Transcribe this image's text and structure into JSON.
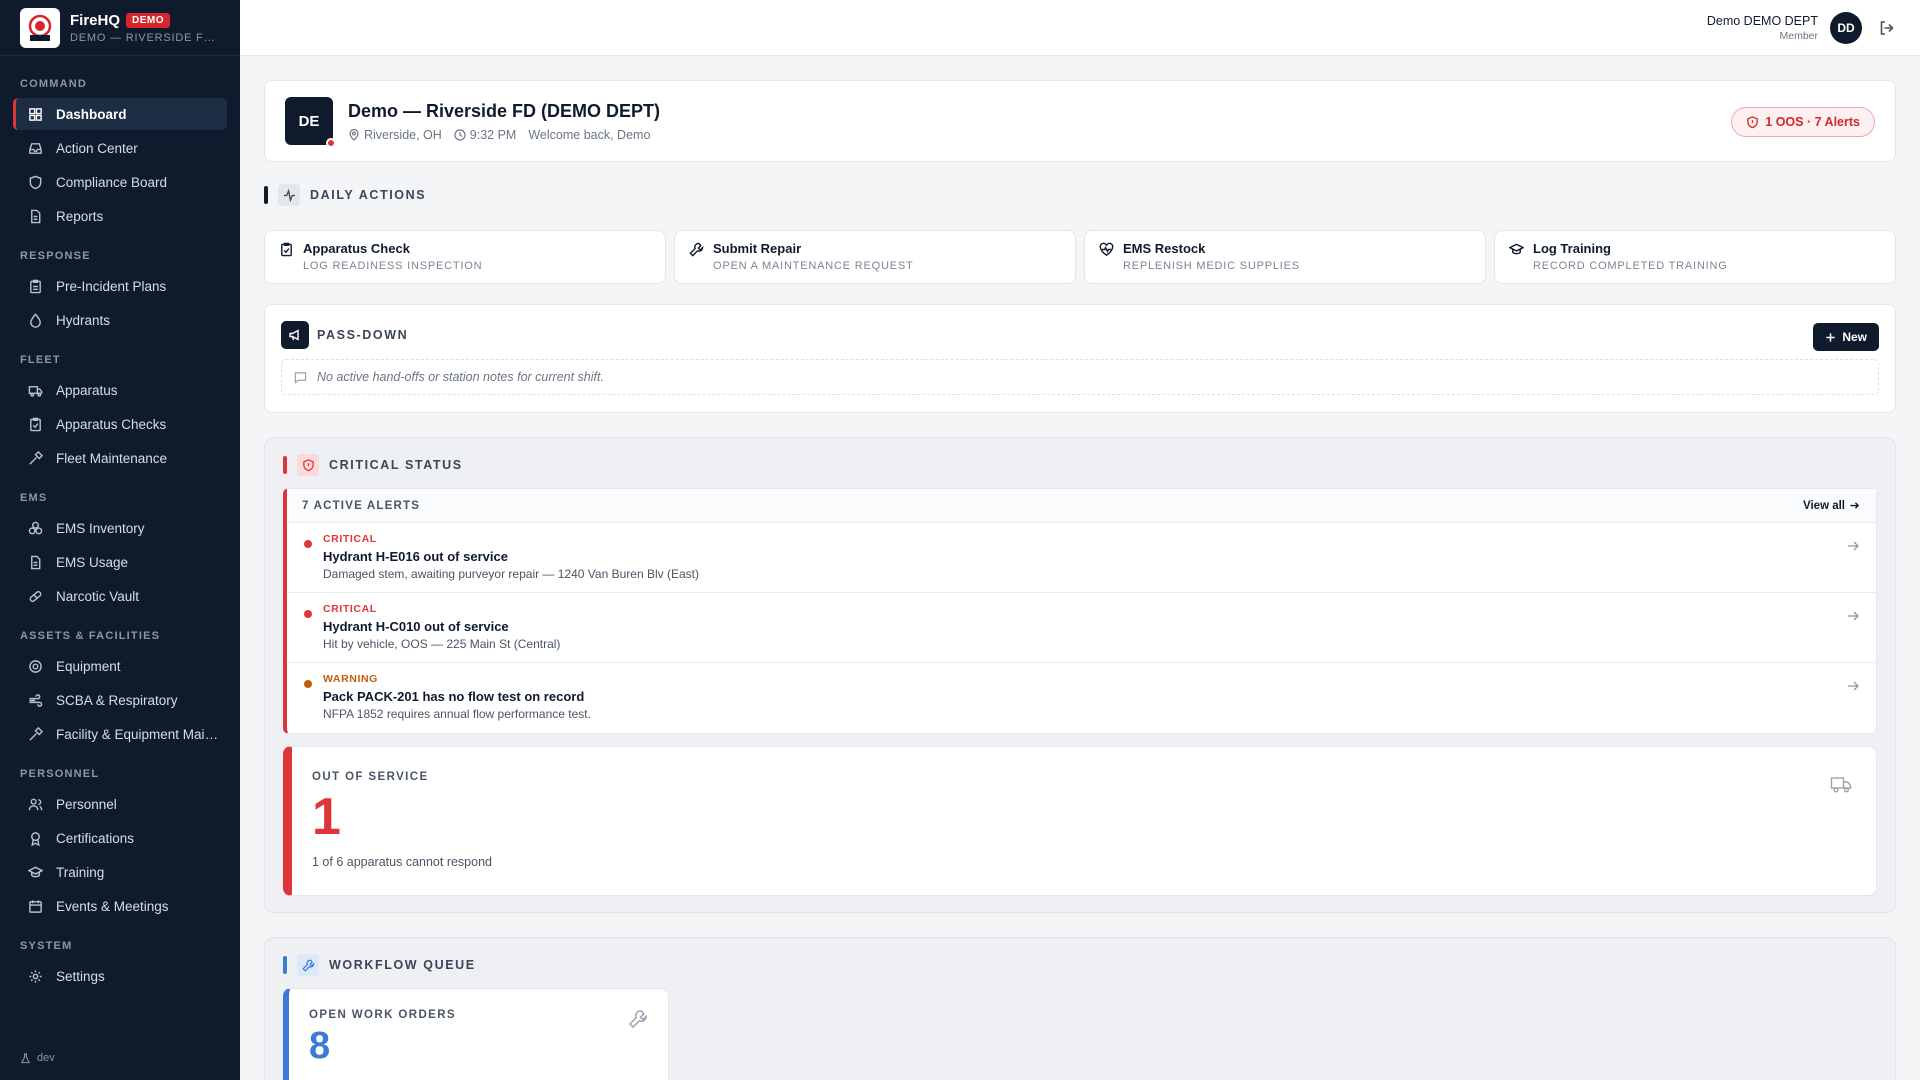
{
  "brand": {
    "name": "FireHQ",
    "badge": "DEMO",
    "subtitle": "DEMO — RIVERSIDE FD (DEMO DEPT)"
  },
  "sidebar": {
    "sections": [
      {
        "title": "COMMAND",
        "items": [
          {
            "label": "Dashboard",
            "icon": "grid-icon",
            "active": true
          },
          {
            "label": "Action Center",
            "icon": "inbox-icon"
          },
          {
            "label": "Compliance Board",
            "icon": "shield-icon"
          },
          {
            "label": "Reports",
            "icon": "document-icon"
          }
        ]
      },
      {
        "title": "RESPONSE",
        "items": [
          {
            "label": "Pre-Incident Plans",
            "icon": "clipboard-icon"
          },
          {
            "label": "Hydrants",
            "icon": "droplet-icon"
          }
        ]
      },
      {
        "title": "FLEET",
        "items": [
          {
            "label": "Apparatus",
            "icon": "truck-icon"
          },
          {
            "label": "Apparatus Checks",
            "icon": "clipboard-check-icon"
          },
          {
            "label": "Fleet Maintenance",
            "icon": "hammer-icon"
          }
        ]
      },
      {
        "title": "EMS",
        "items": [
          {
            "label": "EMS Inventory",
            "icon": "cubes-icon"
          },
          {
            "label": "EMS Usage",
            "icon": "document-icon"
          },
          {
            "label": "Narcotic Vault",
            "icon": "pill-icon"
          }
        ]
      },
      {
        "title": "ASSETS & FACILITIES",
        "items": [
          {
            "label": "Equipment",
            "icon": "cog-icon"
          },
          {
            "label": "SCBA & Respiratory",
            "icon": "wind-icon"
          },
          {
            "label": "Facility & Equipment Maintenance",
            "icon": "hammer-icon"
          }
        ]
      },
      {
        "title": "PERSONNEL",
        "items": [
          {
            "label": "Personnel",
            "icon": "users-icon"
          },
          {
            "label": "Certifications",
            "icon": "award-icon"
          },
          {
            "label": "Training",
            "icon": "graduation-cap-icon"
          },
          {
            "label": "Events & Meetings",
            "icon": "calendar-icon"
          }
        ]
      },
      {
        "title": "SYSTEM",
        "items": [
          {
            "label": "Settings",
            "icon": "gear-icon"
          }
        ]
      }
    ],
    "footer": "dev"
  },
  "topbar": {
    "user_name": "Demo DEMO DEPT",
    "user_role": "Member",
    "avatar": "DD"
  },
  "header": {
    "avatar": "DE",
    "title": "Demo — Riverside FD (DEMO DEPT)",
    "location": "Riverside, OH",
    "time": "9:32 PM",
    "welcome": "Welcome back, Demo",
    "alert_pill": "1 OOS · 7 Alerts"
  },
  "daily_actions": {
    "title": "DAILY ACTIONS",
    "items": [
      {
        "title": "Apparatus Check",
        "sub": "LOG READINESS INSPECTION",
        "icon": "clipboard-check-icon"
      },
      {
        "title": "Submit Repair",
        "sub": "OPEN A MAINTENANCE REQUEST",
        "icon": "wrench-icon"
      },
      {
        "title": "EMS Restock",
        "sub": "REPLENISH MEDIC SUPPLIES",
        "icon": "heart-pulse-icon"
      },
      {
        "title": "Log Training",
        "sub": "RECORD COMPLETED TRAINING",
        "icon": "graduation-cap-icon"
      }
    ]
  },
  "passdown": {
    "title": "PASS-DOWN",
    "new_label": "New",
    "empty": "No active hand-offs or station notes for current shift."
  },
  "critical": {
    "title": "CRITICAL STATUS",
    "alerts_count": "7 ACTIVE ALERTS",
    "view_all": "View all",
    "alerts": [
      {
        "level": "CRITICAL",
        "title": "Hydrant H-E016 out of service",
        "desc": "Damaged stem, awaiting purveyor repair — 1240 Van Buren Blv (East)",
        "color": "#e0343b"
      },
      {
        "level": "CRITICAL",
        "title": "Hydrant H-C010 out of service",
        "desc": "Hit by vehicle, OOS — 225 Main St (Central)",
        "color": "#e0343b"
      },
      {
        "level": "WARNING",
        "title": "Pack PACK-201 has no flow test on record",
        "desc": "NFPA 1852 requires annual flow performance test.",
        "color": "#c25e0c"
      }
    ],
    "oos": {
      "label": "OUT OF SERVICE",
      "value": "1",
      "sub": "1 of 6 apparatus cannot respond"
    }
  },
  "workflow": {
    "title": "WORKFLOW QUEUE",
    "open_work_orders": {
      "label": "OPEN WORK ORDERS",
      "value": "8"
    }
  },
  "colors": {
    "navy": "#0f1b2d",
    "red": "#e0343b",
    "blue": "#3a7bd5",
    "warning": "#c25e0c"
  }
}
